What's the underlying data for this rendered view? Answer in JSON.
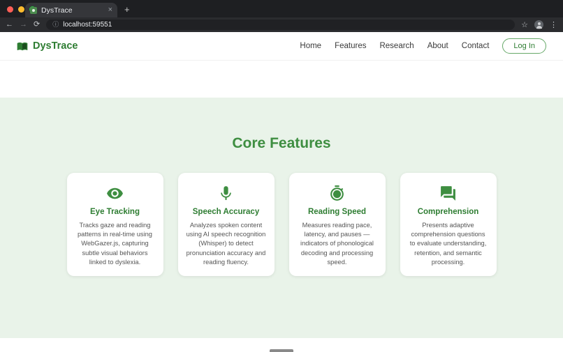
{
  "browser": {
    "tab": {
      "title": "DysTrace",
      "close_glyph": "×",
      "new_tab_glyph": "+"
    },
    "toolbar": {
      "back_glyph": "←",
      "forward_glyph": "→",
      "reload_glyph": "⟳",
      "url": "localhost:59551",
      "info_glyph": "ⓘ",
      "star_glyph": "☆",
      "menu_glyph": "⋮"
    }
  },
  "header": {
    "brand": "DysTrace",
    "nav": [
      {
        "label": "Home"
      },
      {
        "label": "Features"
      },
      {
        "label": "Research"
      },
      {
        "label": "About"
      },
      {
        "label": "Contact"
      }
    ],
    "login_label": "Log In"
  },
  "features": {
    "heading": "Core Features",
    "cards": [
      {
        "icon": "eye-icon",
        "title": "Eye Tracking",
        "text": "Tracks gaze and reading patterns in real-time using WebGazer.js, capturing subtle visual behaviors linked to dyslexia."
      },
      {
        "icon": "microphone-icon",
        "title": "Speech Accuracy",
        "text": "Analyzes spoken content using AI speech recognition (Whisper) to detect pronunciation accuracy and reading fluency."
      },
      {
        "icon": "stopwatch-icon",
        "title": "Reading Speed",
        "text": "Measures reading pace, latency, and pauses — indicators of phonological decoding and processing speed."
      },
      {
        "icon": "chat-icon",
        "title": "Comprehension",
        "text": "Presents adaptive comprehension questions to evaluate understanding, retention, and semantic processing."
      }
    ]
  },
  "theme": {
    "accent_green": "#2e7d32",
    "section_background": "#e9f3e9"
  }
}
